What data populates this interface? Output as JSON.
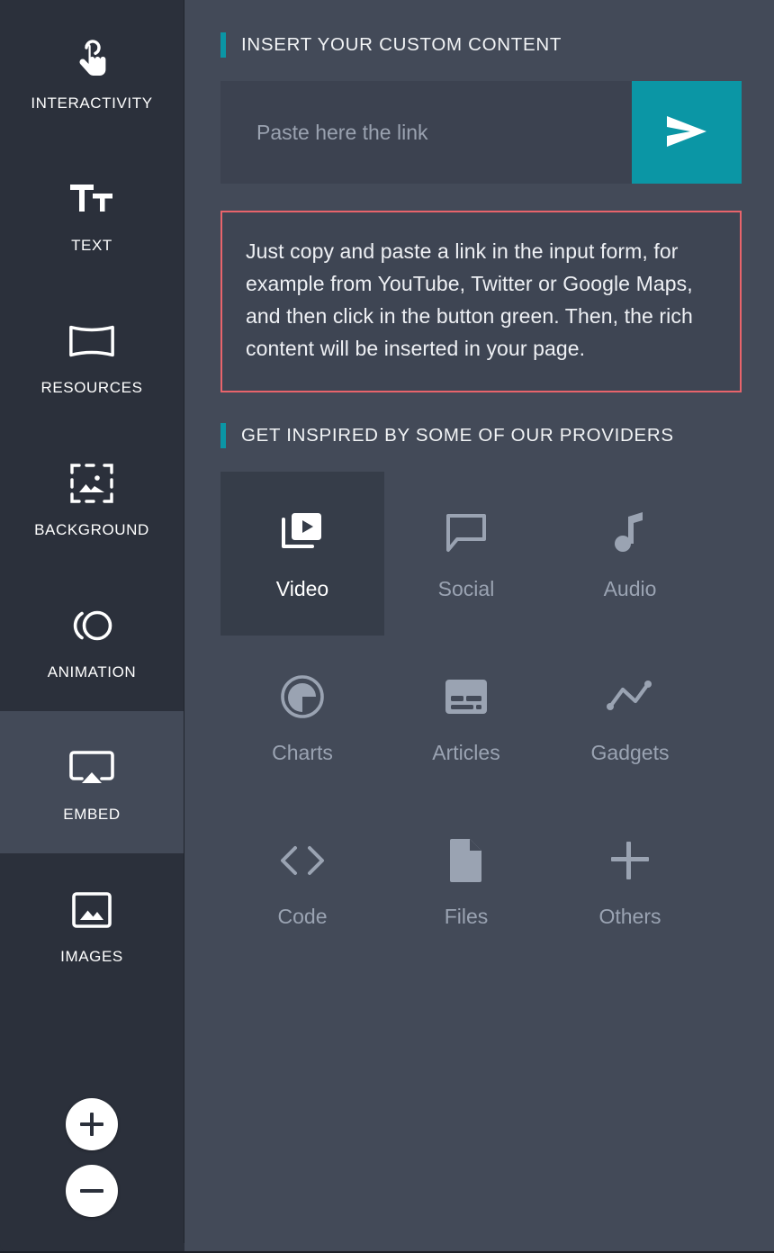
{
  "sidebar": {
    "items": [
      {
        "label": "INTERACTIVITY",
        "icon": "touch-pointer-icon",
        "active": false
      },
      {
        "label": "TEXT",
        "icon": "text-size-icon",
        "active": false
      },
      {
        "label": "RESOURCES",
        "icon": "banner-icon",
        "active": false
      },
      {
        "label": "BACKGROUND",
        "icon": "background-image-icon",
        "active": false
      },
      {
        "label": "ANIMATION",
        "icon": "animation-motion-icon",
        "active": false
      },
      {
        "label": "EMBED",
        "icon": "airplay-screen-icon",
        "active": true
      },
      {
        "label": "IMAGES",
        "icon": "image-icon",
        "active": false
      }
    ],
    "zoom_controls": [
      {
        "name": "zoom-in",
        "glyph": "+"
      },
      {
        "name": "zoom-out",
        "glyph": "−"
      }
    ]
  },
  "main": {
    "insert_section": {
      "title": "INSERT YOUR CUSTOM CONTENT",
      "accent_color": "#0b96a5",
      "input": {
        "placeholder": "Paste here the link",
        "value": ""
      },
      "send_button": {
        "icon": "send-paper-plane-icon",
        "color": "#0b96a5"
      }
    },
    "info_box": {
      "border_color": "#e8646b",
      "text": "Just copy and paste a link in the input form, for example from YouTube, Twitter or Google Maps, and then click in the button green. Then, the rich content will be inserted in your page."
    },
    "providers_section": {
      "title": "GET INSPIRED BY SOME OF OUR PROVIDERS",
      "accent_color": "#0b96a5",
      "tiles": [
        {
          "label": "Video",
          "icon": "video-play-stack-icon",
          "active": true
        },
        {
          "label": "Social",
          "icon": "speech-bubble-icon",
          "active": false
        },
        {
          "label": "Audio",
          "icon": "music-note-icon",
          "active": false
        },
        {
          "label": "Charts",
          "icon": "pie-chart-icon",
          "active": false
        },
        {
          "label": "Articles",
          "icon": "article-card-icon",
          "active": false
        },
        {
          "label": "Gadgets",
          "icon": "line-chart-icon",
          "active": false
        },
        {
          "label": "Code",
          "icon": "code-brackets-icon",
          "active": false
        },
        {
          "label": "Files",
          "icon": "file-document-icon",
          "active": false
        },
        {
          "label": "Others",
          "icon": "plus-icon",
          "active": false
        }
      ]
    }
  },
  "theme": {
    "sidebar_bg": "#2b303b",
    "main_bg": "#434a58",
    "input_bg": "#3c4250",
    "accent_teal": "#0b96a5",
    "alert_red": "#e8646b",
    "muted_text": "#9aa3b2",
    "active_tile_bg": "#363d49"
  }
}
